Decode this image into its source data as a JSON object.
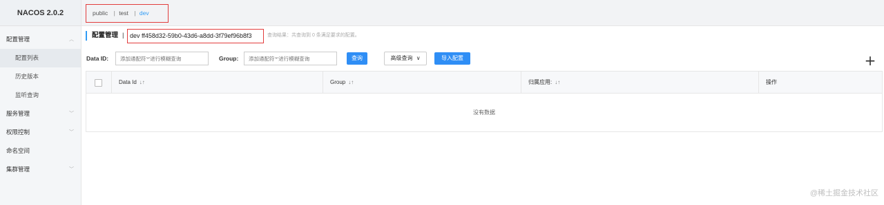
{
  "app": {
    "logo": "NACOS 2.0.2"
  },
  "sidebar": {
    "items": [
      {
        "label": "配置管理",
        "chevron": "^"
      },
      {
        "label": "配置列表"
      },
      {
        "label": "历史版本"
      },
      {
        "label": "监听查询"
      },
      {
        "label": "服务管理",
        "chevron": "v"
      },
      {
        "label": "权限控制",
        "chevron": "v"
      },
      {
        "label": "命名空间"
      },
      {
        "label": "集群管理",
        "chevron": "v"
      }
    ]
  },
  "namespaces": {
    "tabs": [
      "public",
      "test",
      "dev"
    ],
    "separator": "|",
    "active": "dev"
  },
  "header": {
    "title": "配置管理",
    "separator": "|",
    "namespace_display": "dev ff458d32-59b0-43d6-a8dd-3f79ef96b8f3",
    "query_result": "查询结果：共查询到 0 条满足要求的配置。"
  },
  "search": {
    "dataid_label": "Data ID:",
    "dataid_placeholder": "添加通配符'*'进行模糊查询",
    "group_label": "Group:",
    "group_placeholder": "添加通配符'*'进行模糊查询",
    "query_button": "查询",
    "advanced_query": "高级查询",
    "import_button": "导入配置",
    "add_button": "+"
  },
  "table": {
    "columns": [
      "Data Id",
      "Group",
      "归属应用:",
      "操作"
    ],
    "sort_icon": "↓↑",
    "empty_text": "没有数据"
  },
  "watermark": "@稀土掘金技术社区",
  "colors": {
    "accent": "#2f8ef5",
    "highlight_border": "#e23b3b",
    "active_tab": "#2f9bf5"
  }
}
